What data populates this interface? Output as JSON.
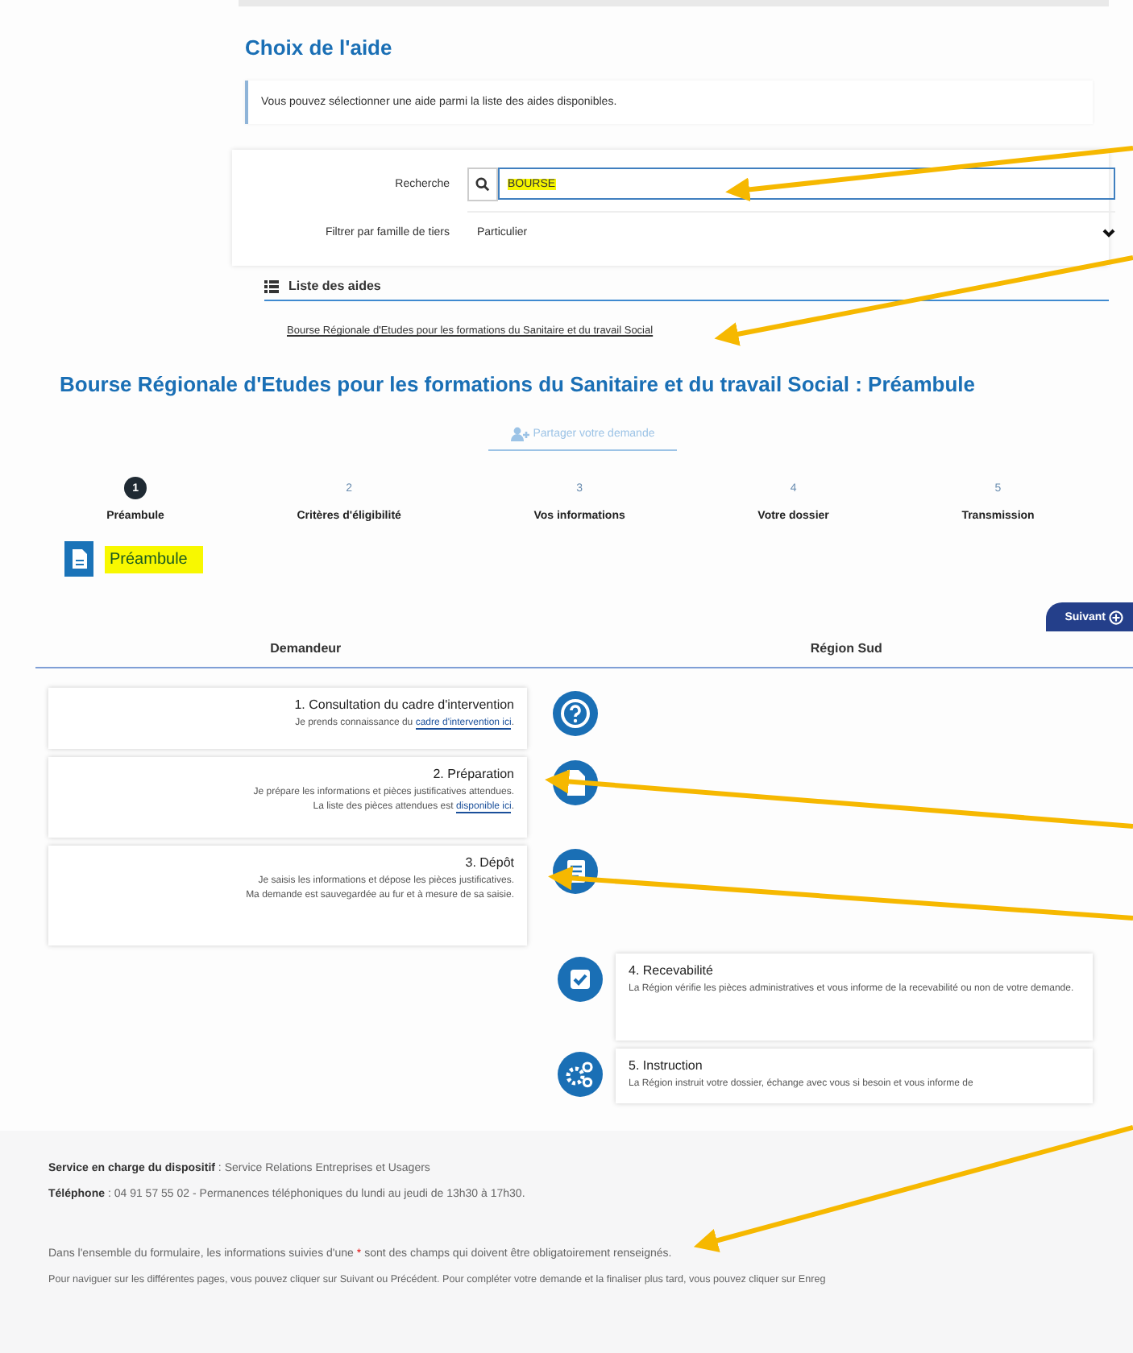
{
  "heading": "Choix de l'aide",
  "info": "Vous pouvez sélectionner une aide parmi la liste des aides disponibles.",
  "search": {
    "label": "Recherche",
    "value": "BOURSE"
  },
  "filter": {
    "label": "Filtrer par famille de tiers",
    "value": "Particulier"
  },
  "aid_list": {
    "title": "Liste des aides",
    "items": [
      "Bourse Régionale d'Etudes pour les formations du Sanitaire et du travail Social"
    ]
  },
  "page_title": "Bourse Régionale d'Etudes pour les formations du Sanitaire et du travail Social : Préambule",
  "share_button": "Partager votre demande",
  "steps": [
    {
      "number": "1",
      "label": "Préambule",
      "selected": true
    },
    {
      "number": "2",
      "label": "Critères d'éligibilité",
      "selected": false
    },
    {
      "number": "3",
      "label": "Vos informations",
      "selected": false
    },
    {
      "number": "4",
      "label": "Votre dossier",
      "selected": false
    },
    {
      "number": "5",
      "label": "Transmission",
      "selected": false
    }
  ],
  "section_title": "Préambule",
  "next_button": "Suivant",
  "columns": [
    "Demandeur",
    "Région Sud"
  ],
  "timeline": [
    {
      "kind": "applicant",
      "title": "1. Consultation du cadre d'intervention",
      "lines": [
        [
          {
            "kind": "text",
            "text": "Je prends connaissance du "
          },
          {
            "kind": "link",
            "text": "cadre d'intervention ici"
          },
          {
            "kind": "text",
            "text": "."
          }
        ]
      ]
    },
    {
      "kind": "applicant",
      "title": "2. Préparation",
      "lines": [
        [
          {
            "kind": "text",
            "text": "Je prépare les informations et pièces justificatives attendues."
          }
        ],
        [
          {
            "kind": "text",
            "text": "La liste des pièces attendues est "
          },
          {
            "kind": "link",
            "text": "disponible ici"
          },
          {
            "kind": "text",
            "text": "."
          }
        ]
      ]
    },
    {
      "kind": "applicant",
      "title": "3. Dépôt",
      "lines": [
        [
          {
            "kind": "text",
            "text": "Je saisis les informations et dépose les pièces justificatives."
          }
        ],
        [
          {
            "kind": "text",
            "text": "Ma demande est sauvegardée au fur et à mesure de sa saisie."
          }
        ]
      ]
    },
    {
      "kind": "region",
      "title": "4. Recevabilité",
      "lines": [
        [
          {
            "kind": "text",
            "text": "La Région vérifie les pièces administratives et vous informe de la recevabilité ou non de votre demande."
          }
        ]
      ]
    },
    {
      "kind": "region",
      "title": "5. Instruction",
      "lines": [
        [
          {
            "kind": "text",
            "text": "La Région instruit votre dossier, échange avec vous si besoin et vous informe de"
          }
        ]
      ]
    }
  ],
  "contact": [
    {
      "label": "Service en charge du dispositif",
      "value": " : Service Relations Entreprises et Usagers"
    },
    {
      "label": "Téléphone",
      "value": " : 04 91 57 55 02 - Permanences téléphoniques du lundi au jeudi de 13h30 à 17h30."
    }
  ],
  "required_note": {
    "before": "Dans l'ensemble du formulaire, les informations suivies d'une ",
    "mark": "*",
    "after": " sont des champs qui doivent être obligatoirement renseignés."
  },
  "navigation_note": "Pour naviguer sur les différentes pages, vous pouvez cliquer sur Suivant ou Précédent. Pour compléter votre demande et la finaliser plus tard, vous pouvez cliquer sur Enreg"
}
